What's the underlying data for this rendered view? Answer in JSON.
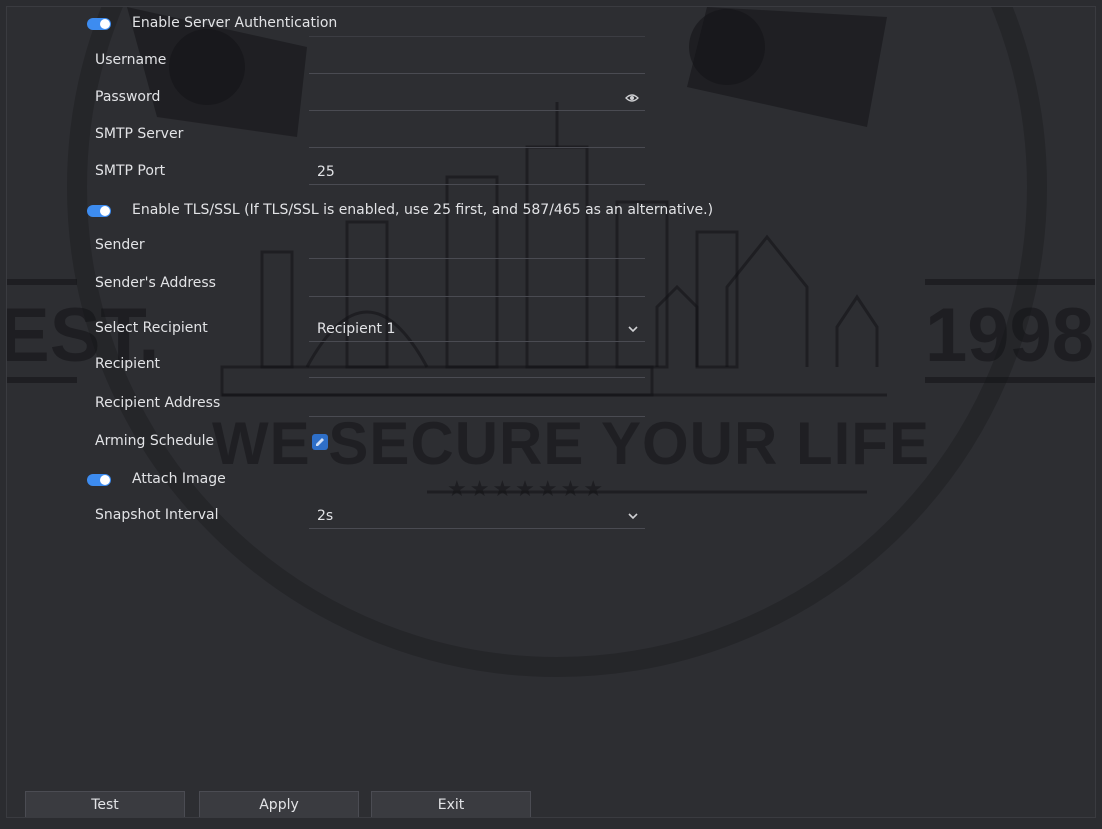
{
  "settings": {
    "enable_server_auth": {
      "label": "Enable Server Authentication",
      "on": true
    },
    "username": {
      "label": "Username",
      "value": ""
    },
    "password": {
      "label": "Password",
      "value": "",
      "icon": "eye-icon"
    },
    "smtp_server": {
      "label": "SMTP Server",
      "value": ""
    },
    "smtp_port": {
      "label": "SMTP Port",
      "value": "25"
    },
    "enable_tls": {
      "label": "Enable TLS/SSL (If TLS/SSL is enabled, use 25 first, and 587/465 as an alternative.)",
      "on": true
    },
    "sender": {
      "label": "Sender",
      "value": ""
    },
    "sender_address": {
      "label": "Sender's Address",
      "value": ""
    },
    "select_recipient": {
      "label": "Select Recipient",
      "value": "Recipient 1"
    },
    "recipient": {
      "label": "Recipient",
      "value": ""
    },
    "recipient_address": {
      "label": "Recipient Address",
      "value": ""
    },
    "arming_schedule": {
      "label": "Arming Schedule",
      "icon": "edit-schedule-icon"
    },
    "attach_image": {
      "label": "Attach Image",
      "on": true
    },
    "snapshot_interval": {
      "label": "Snapshot Interval",
      "value": "2s"
    }
  },
  "footer": {
    "test": "Test",
    "apply": "Apply",
    "exit": "Exit"
  },
  "watermark": {
    "slogan": "WE SECURE YOUR LIFE",
    "year": "1998",
    "est": "EST.",
    "stars": "★★★★★★★"
  },
  "colors": {
    "accent": "#3d8cf0",
    "background": "#2d2e32",
    "text": "#e2e3e6"
  }
}
